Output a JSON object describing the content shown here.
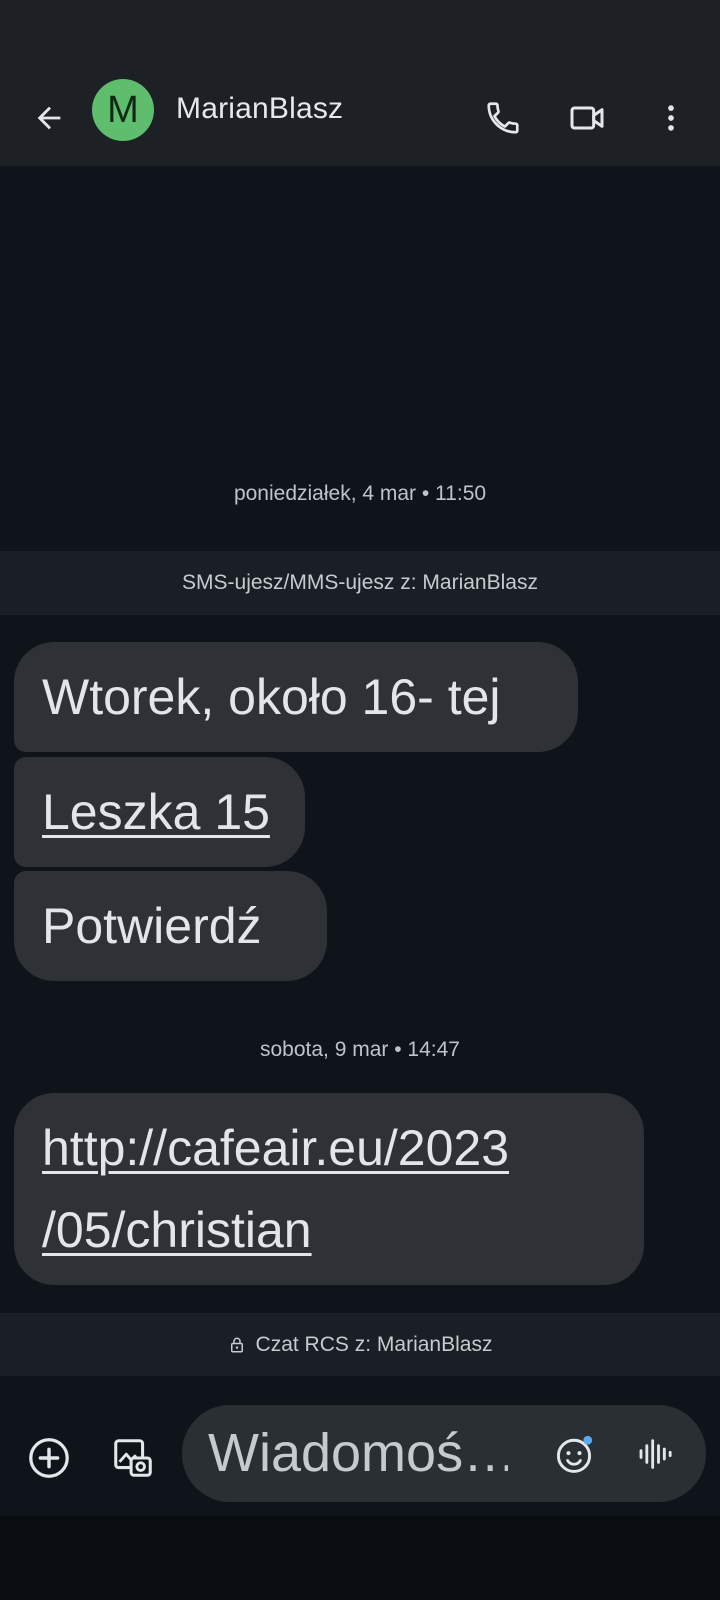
{
  "header": {
    "avatar_letter": "M",
    "contact_name": "MarianBlasz",
    "avatar_color": "#5fbd6e",
    "icons": [
      "back-arrow-icon",
      "phone-icon",
      "video-camera-icon",
      "more-vert-icon"
    ]
  },
  "conversation": {
    "timestamp_1": "poniedziałek, 4 mar • 11:50",
    "sms_info": "SMS-ujesz/MMS-ujesz z: MarianBlasz",
    "messages_group_1": [
      {
        "text": "Wtorek, około 16- tej"
      },
      {
        "text": "Leszka 15"
      },
      {
        "text": "Potwierdź"
      }
    ],
    "timestamp_2": "sobota, 9 mar • 14:47",
    "messages_group_2": [
      {
        "text_line_1": "http://cafeair.eu/2023",
        "text_line_2": "/05/christian"
      }
    ],
    "rcs_info": "Czat RCS z: MarianBlasz"
  },
  "compose": {
    "placeholder": "Wiadomoś…",
    "icons": [
      "add-circle-icon",
      "gallery-icon",
      "emoji-icon",
      "voice-wave-icon"
    ]
  }
}
